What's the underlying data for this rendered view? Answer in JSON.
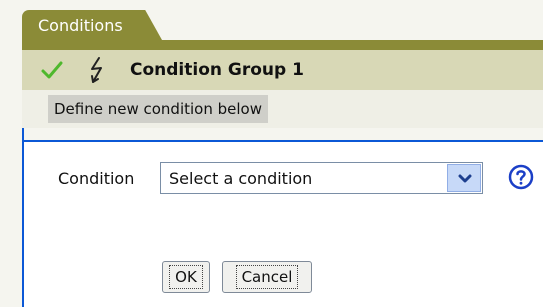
{
  "tab": {
    "label": "Conditions"
  },
  "group": {
    "title": "Condition Group 1",
    "icons": [
      "check-icon",
      "lightning-icon"
    ]
  },
  "define": {
    "text": "Define new condition below"
  },
  "editor": {
    "condition_label": "Condition",
    "select_value": "Select a condition",
    "help_icon": "question-circle-icon",
    "ok_label": "OK",
    "cancel_label": "Cancel"
  },
  "colors": {
    "tab": "#8b8b37",
    "group_bar": "#d8d8b6",
    "check": "#4fb82d",
    "editor_border": "#0b58d6",
    "help": "#1b3fc7"
  }
}
